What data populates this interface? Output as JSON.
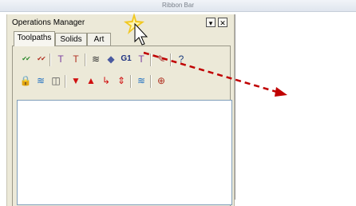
{
  "ribbon": {
    "label": "Ribbon Bar"
  },
  "panel": {
    "title": "Operations Manager",
    "dropdown_label": "▾",
    "close_label": "✕"
  },
  "tabs": [
    {
      "label": "Toolpaths",
      "active": true
    },
    {
      "label": "Solids",
      "active": false
    },
    {
      "label": "Art",
      "active": false
    }
  ],
  "toolbar1": [
    {
      "icon": "select-all-operations-icon",
      "glyph": "✔✔",
      "color": "#2e8b2e"
    },
    {
      "icon": "select-invalid-operations-icon",
      "glyph": "✔✔",
      "color": "#b03020"
    },
    {
      "icon": "regenerate-selected-icon",
      "glyph": "T",
      "color": "#7b3fa0"
    },
    {
      "icon": "regenerate-dirty-icon",
      "glyph": "T",
      "color": "#b03020"
    },
    {
      "icon": "backplot-icon",
      "glyph": "≋",
      "color": "#303030"
    },
    {
      "icon": "verify-icon",
      "glyph": "◆",
      "color": "#4a5aa0"
    },
    {
      "icon": "post-selected-icon",
      "glyph": "G1",
      "color": "#1b2f80"
    },
    {
      "icon": "highfeed-icon",
      "glyph": "T",
      "color": "#7b3fa0"
    },
    {
      "icon": "delete-operations-icon",
      "glyph": "✎",
      "color": "#a02020"
    },
    {
      "icon": "help-icon",
      "glyph": "?",
      "color": "#204080"
    }
  ],
  "toolbar2": [
    {
      "icon": "lock-icon",
      "glyph": "🔒",
      "color": "#c08a00"
    },
    {
      "icon": "toggle-posting-icon",
      "glyph": "≋",
      "color": "#1f6fc0"
    },
    {
      "icon": "toggle-display-icon",
      "glyph": "◫",
      "color": "#505050"
    },
    {
      "icon": "move-down-icon",
      "glyph": "▼",
      "color": "#d01010"
    },
    {
      "icon": "move-up-icon",
      "glyph": "▲",
      "color": "#d01010"
    },
    {
      "icon": "insert-arrow-icon",
      "glyph": "↳",
      "color": "#d01010"
    },
    {
      "icon": "scroll-icon",
      "glyph": "⇕",
      "color": "#d01010"
    },
    {
      "icon": "single-visible-icon",
      "glyph": "≋",
      "color": "#1f6fc0"
    },
    {
      "icon": "display-options-icon",
      "glyph": "⊕",
      "color": "#b03020"
    }
  ],
  "colors": {
    "annotation_arrow": "#c00000",
    "cursor_highlight": "#f2c200"
  }
}
